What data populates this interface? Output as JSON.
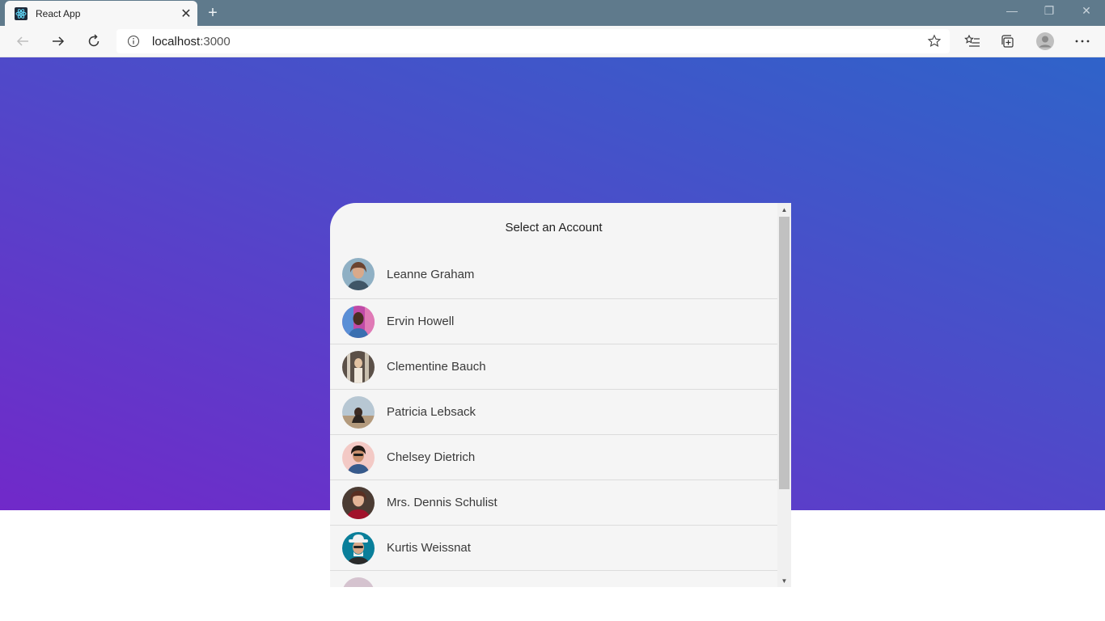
{
  "browser": {
    "tab_title": "React App",
    "tab_close": "✕",
    "new_tab": "+",
    "url_host": "localhost",
    "url_port": ":3000",
    "window_buttons": {
      "minimize": "—",
      "restore": "❐",
      "close": "✕"
    }
  },
  "panel": {
    "title": "Select an Account",
    "accounts": [
      {
        "name": "Leanne Graham"
      },
      {
        "name": "Ervin Howell"
      },
      {
        "name": "Clementine Bauch"
      },
      {
        "name": "Patricia Lebsack"
      },
      {
        "name": "Chelsey Dietrich"
      },
      {
        "name": "Mrs. Dennis Schulist"
      },
      {
        "name": "Kurtis Weissnat"
      },
      {
        "name": ""
      }
    ]
  },
  "colors": {
    "gradient_top": "#2f63c9",
    "gradient_bottom": "#7129c9",
    "panel_bg": "#f5f5f5",
    "titlebar": "#5f7a8c"
  },
  "icons": {
    "favicon": "react-atom-icon",
    "info": "info-icon",
    "favorite": "star-icon"
  }
}
